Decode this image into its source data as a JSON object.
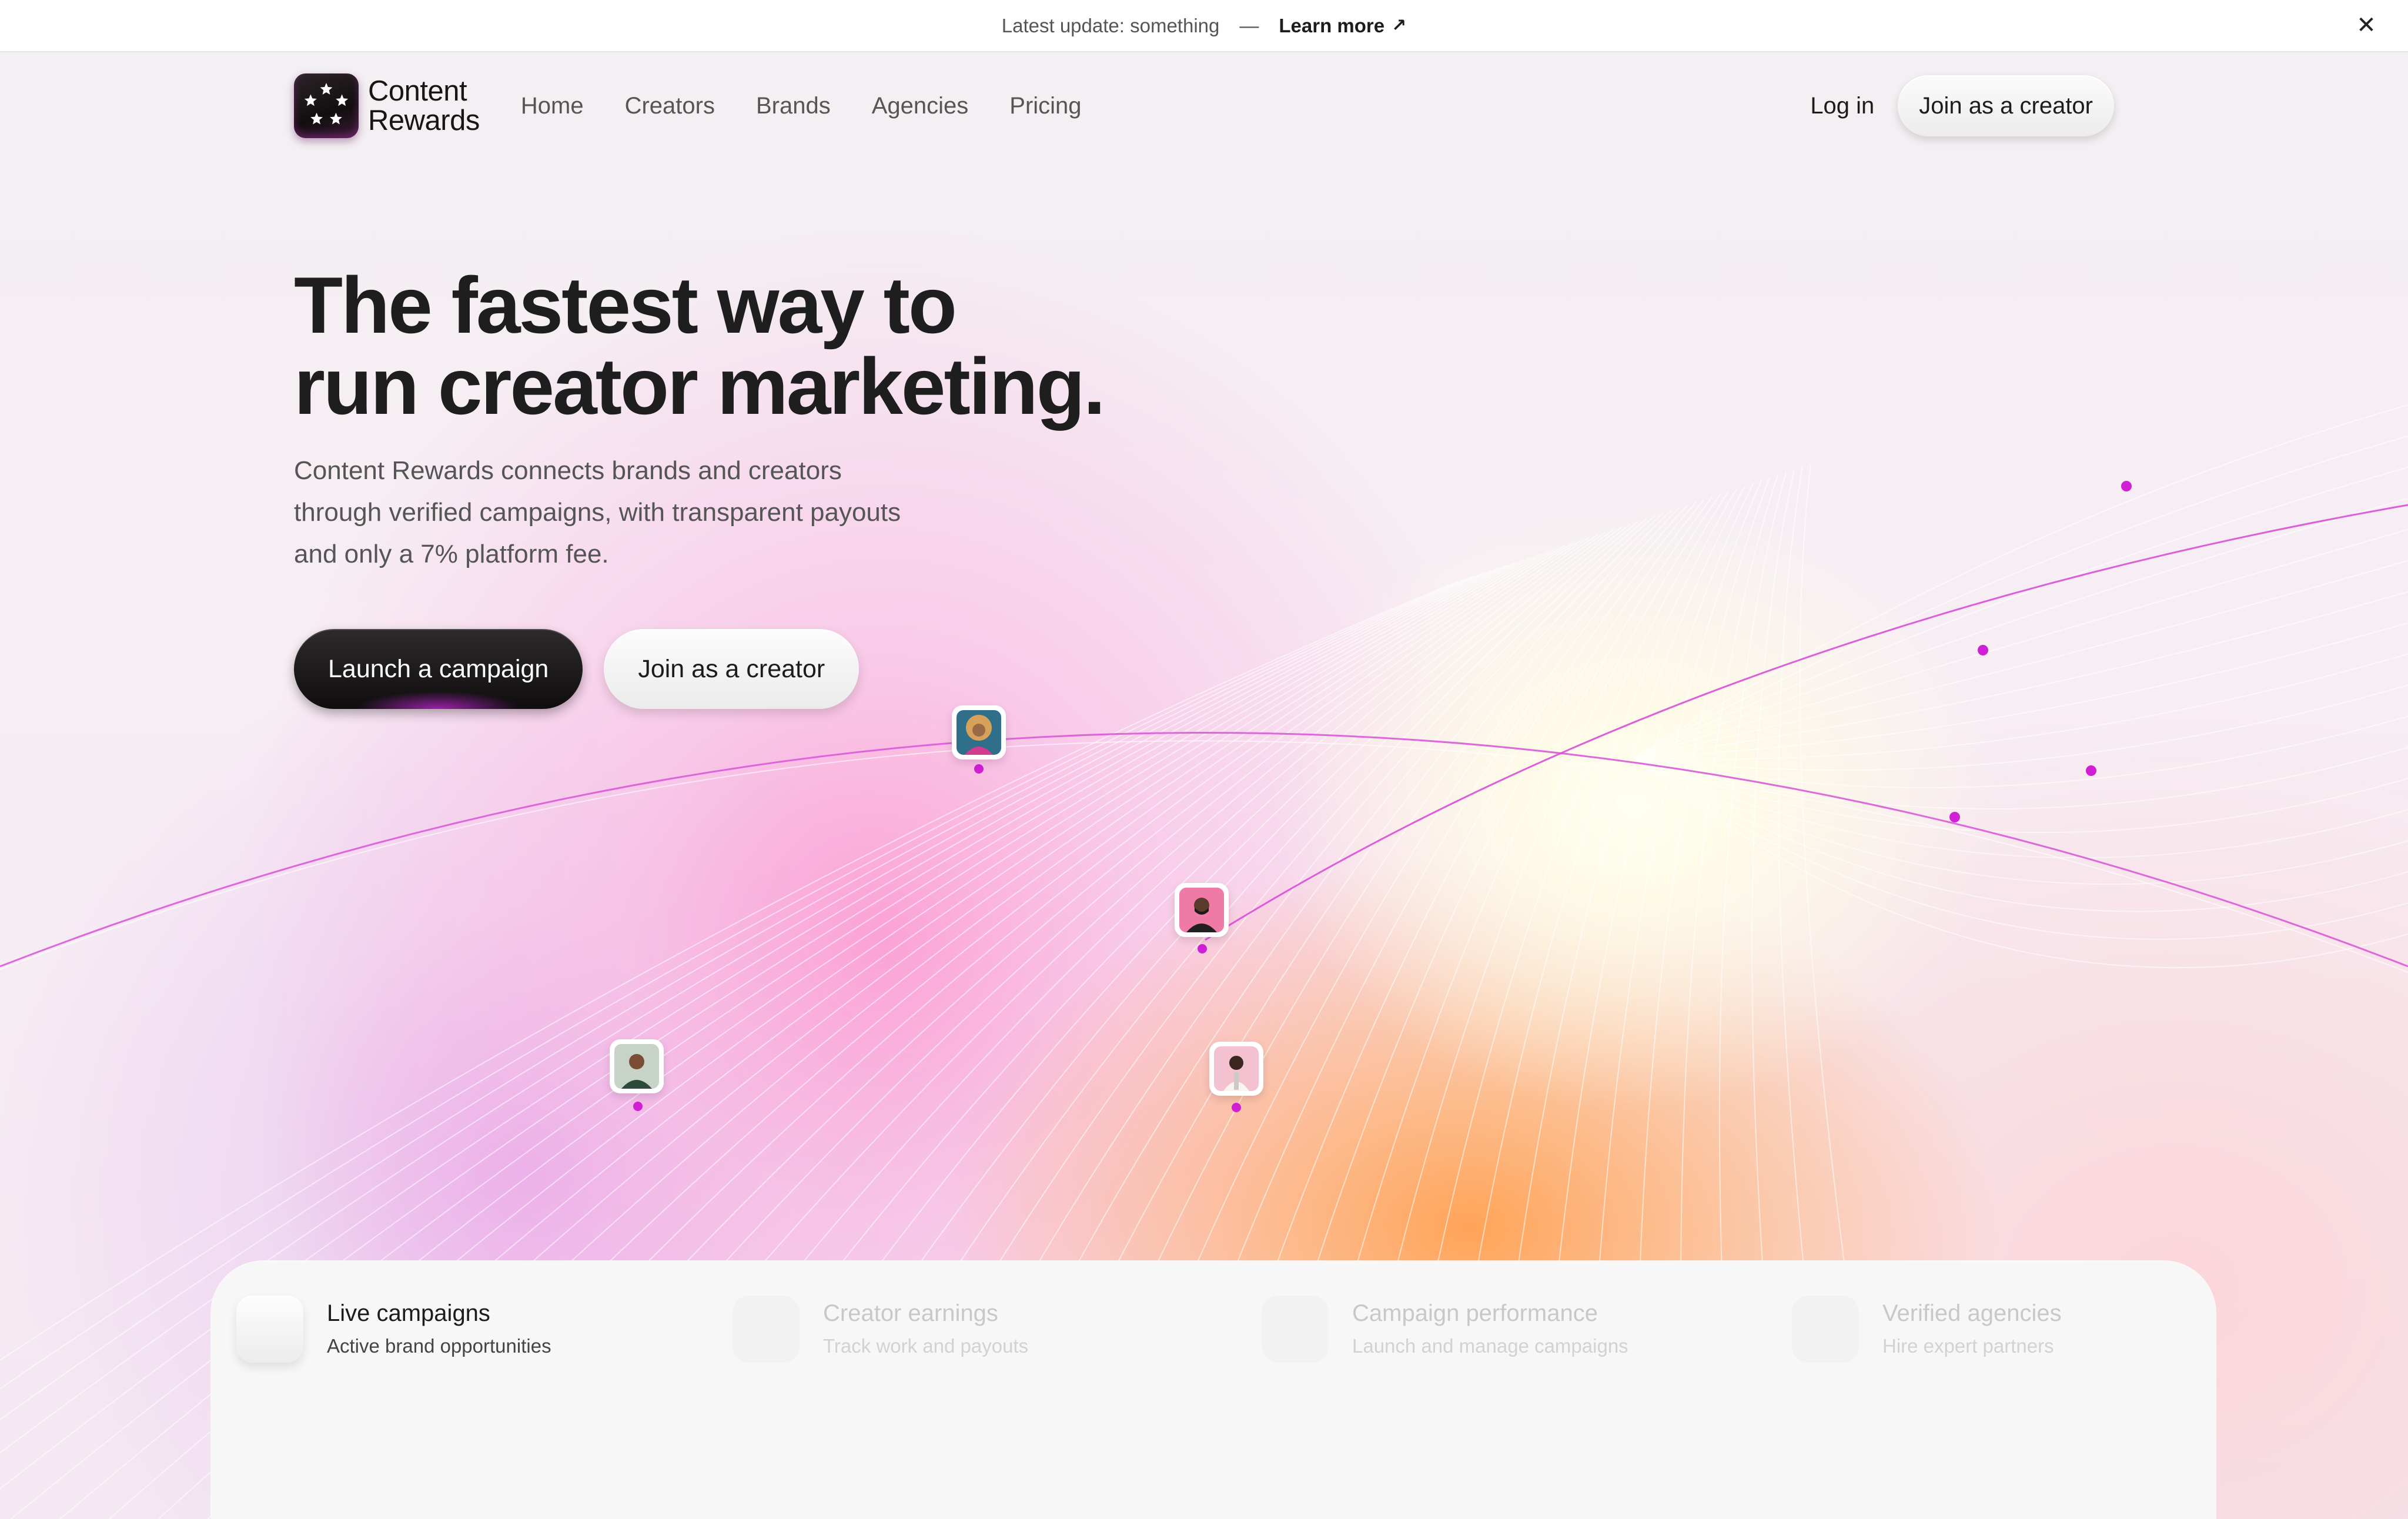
{
  "announcement": {
    "text": "Latest update: something",
    "separator": "—",
    "link_label": "Learn more",
    "link_icon": "arrow-up-right-icon",
    "close_icon": "close-icon"
  },
  "brand": {
    "name_line1": "Content",
    "name_line2": "Rewards",
    "logo_icon": "stars-ring-icon"
  },
  "nav": {
    "items": [
      "Home",
      "Creators",
      "Brands",
      "Agencies",
      "Pricing"
    ],
    "login_label": "Log in",
    "join_label": "Join as a creator"
  },
  "hero": {
    "headline_line1": "The fastest way to",
    "headline_line2": "run creator marketing.",
    "subtext": "Content Rewards connects brands and creators through verified campaigns, with transparent payouts and only a 7% platform fee.",
    "primary_cta": "Launch a campaign",
    "secondary_cta": "Join as a creator"
  },
  "features": {
    "tabs": [
      {
        "title": "Live campaigns",
        "subtitle": "Active brand opportunities",
        "active": true
      },
      {
        "title": "Creator earnings",
        "subtitle": "Track work and payouts",
        "active": false
      },
      {
        "title": "Campaign performance",
        "subtitle": "Launch and manage campaigns",
        "active": false
      },
      {
        "title": "Verified agencies",
        "subtitle": "Hire expert partners",
        "active": false
      }
    ]
  },
  "colors": {
    "accent": "#d63ad8",
    "primary_button": "#151213",
    "text": "#1e1e1e"
  }
}
